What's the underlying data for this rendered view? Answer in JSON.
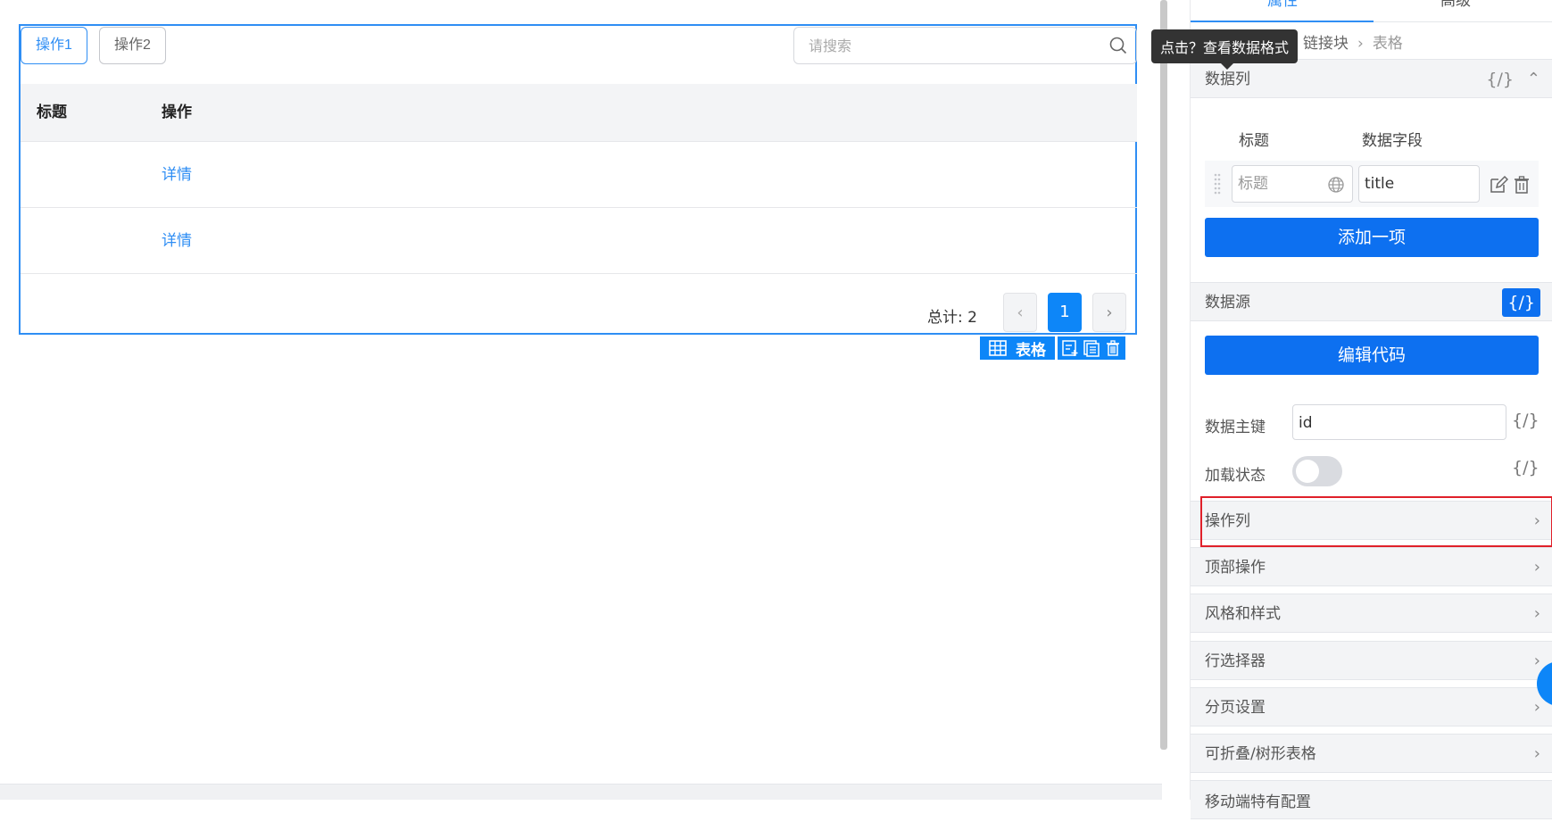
{
  "canvas": {
    "table": {
      "toolbar_buttons": [
        "操作1",
        "操作2"
      ],
      "search_placeholder": "请搜索",
      "columns": [
        "标题",
        "操作"
      ],
      "rows": [
        {
          "title": "",
          "action": "详情"
        },
        {
          "title": "",
          "action": "详情"
        }
      ],
      "total_label": "总计: 2",
      "pagination": {
        "prev": "‹",
        "current": "1",
        "next": "›"
      }
    },
    "component_toolbar": {
      "label": "表格"
    }
  },
  "panel": {
    "tabs": {
      "attributes": "属性",
      "advanced": "高级"
    },
    "breadcrumb": {
      "parent": "链接块",
      "current": "表格"
    },
    "tooltip": "点击？查看数据格式",
    "data_columns": {
      "title": "数据列",
      "code": "{/}",
      "header_title": "标题",
      "header_field": "数据字段",
      "row": {
        "title_placeholder": "标题",
        "field_value": "title"
      },
      "add_button": "添加一项"
    },
    "data_source": {
      "title": "数据源",
      "code": "{/}",
      "edit_button": "编辑代码",
      "primary_key_label": "数据主键",
      "primary_key_value": "id",
      "loading_label": "加载状态",
      "loading_on": false
    },
    "sections": [
      "操作列",
      "顶部操作",
      "风格和样式",
      "行选择器",
      "分页设置",
      "可折叠/树形表格",
      "移动端特有配置"
    ]
  }
}
